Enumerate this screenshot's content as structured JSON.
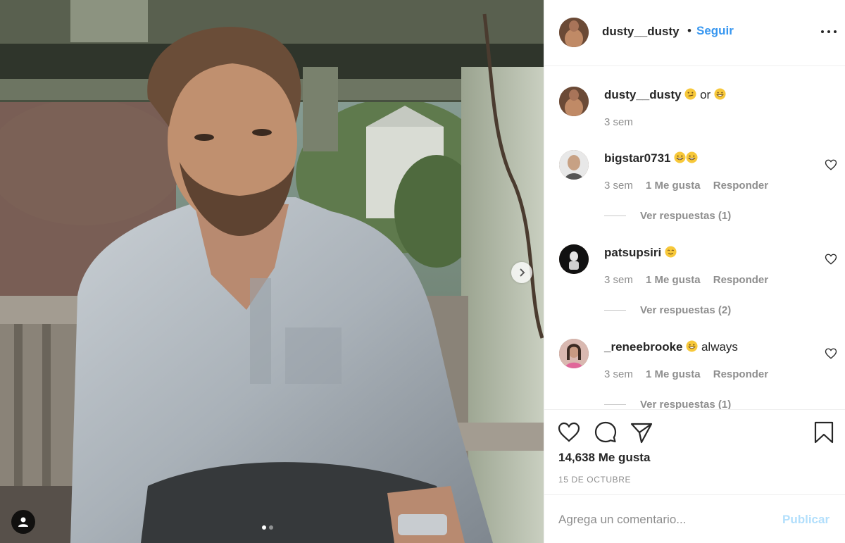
{
  "header": {
    "username": "dusty__dusty",
    "separator": "•",
    "follow_label": "Seguir",
    "more_icon": "more-horizontal-icon"
  },
  "caption": {
    "username": "dusty__dusty",
    "text_before": "",
    "emoji_1": "smirk-emoji",
    "middle_text": "or",
    "emoji_2": "grin-emoji",
    "time": "3 sem"
  },
  "comments": [
    {
      "username": "bigstar0731",
      "text": "",
      "emojis": [
        "grin-emoji",
        "grin-emoji"
      ],
      "time": "3 sem",
      "likes": "1 Me gusta",
      "reply_label": "Responder",
      "view_replies": "Ver respuestas (1)"
    },
    {
      "username": "patsupsiri",
      "text": "",
      "emojis": [
        "smile-emoji"
      ],
      "time": "3 sem",
      "likes": "1 Me gusta",
      "reply_label": "Responder",
      "view_replies": "Ver respuestas (2)"
    },
    {
      "username": "_reneebrooke",
      "text": "always",
      "emojis": [
        "grin-emoji"
      ],
      "time": "3 sem",
      "likes": "1 Me gusta",
      "reply_label": "Responder",
      "view_replies": "Ver respuestas (1)"
    }
  ],
  "actions": {
    "like_icon": "heart-icon",
    "comment_icon": "comment-icon",
    "share_icon": "paper-plane-icon",
    "save_icon": "bookmark-icon"
  },
  "likes_count": "14,638 Me gusta",
  "post_date": "15 DE OCTUBRE",
  "composer": {
    "placeholder": "Agrega un comentario...",
    "post_label": "Publicar"
  },
  "carousel": {
    "slide_count": 2,
    "active_slide": 1
  },
  "colors": {
    "link_blue": "#3897f0",
    "post_disabled": "#b2dffc",
    "muted_text": "#8e8e8e",
    "border": "#efefef"
  }
}
